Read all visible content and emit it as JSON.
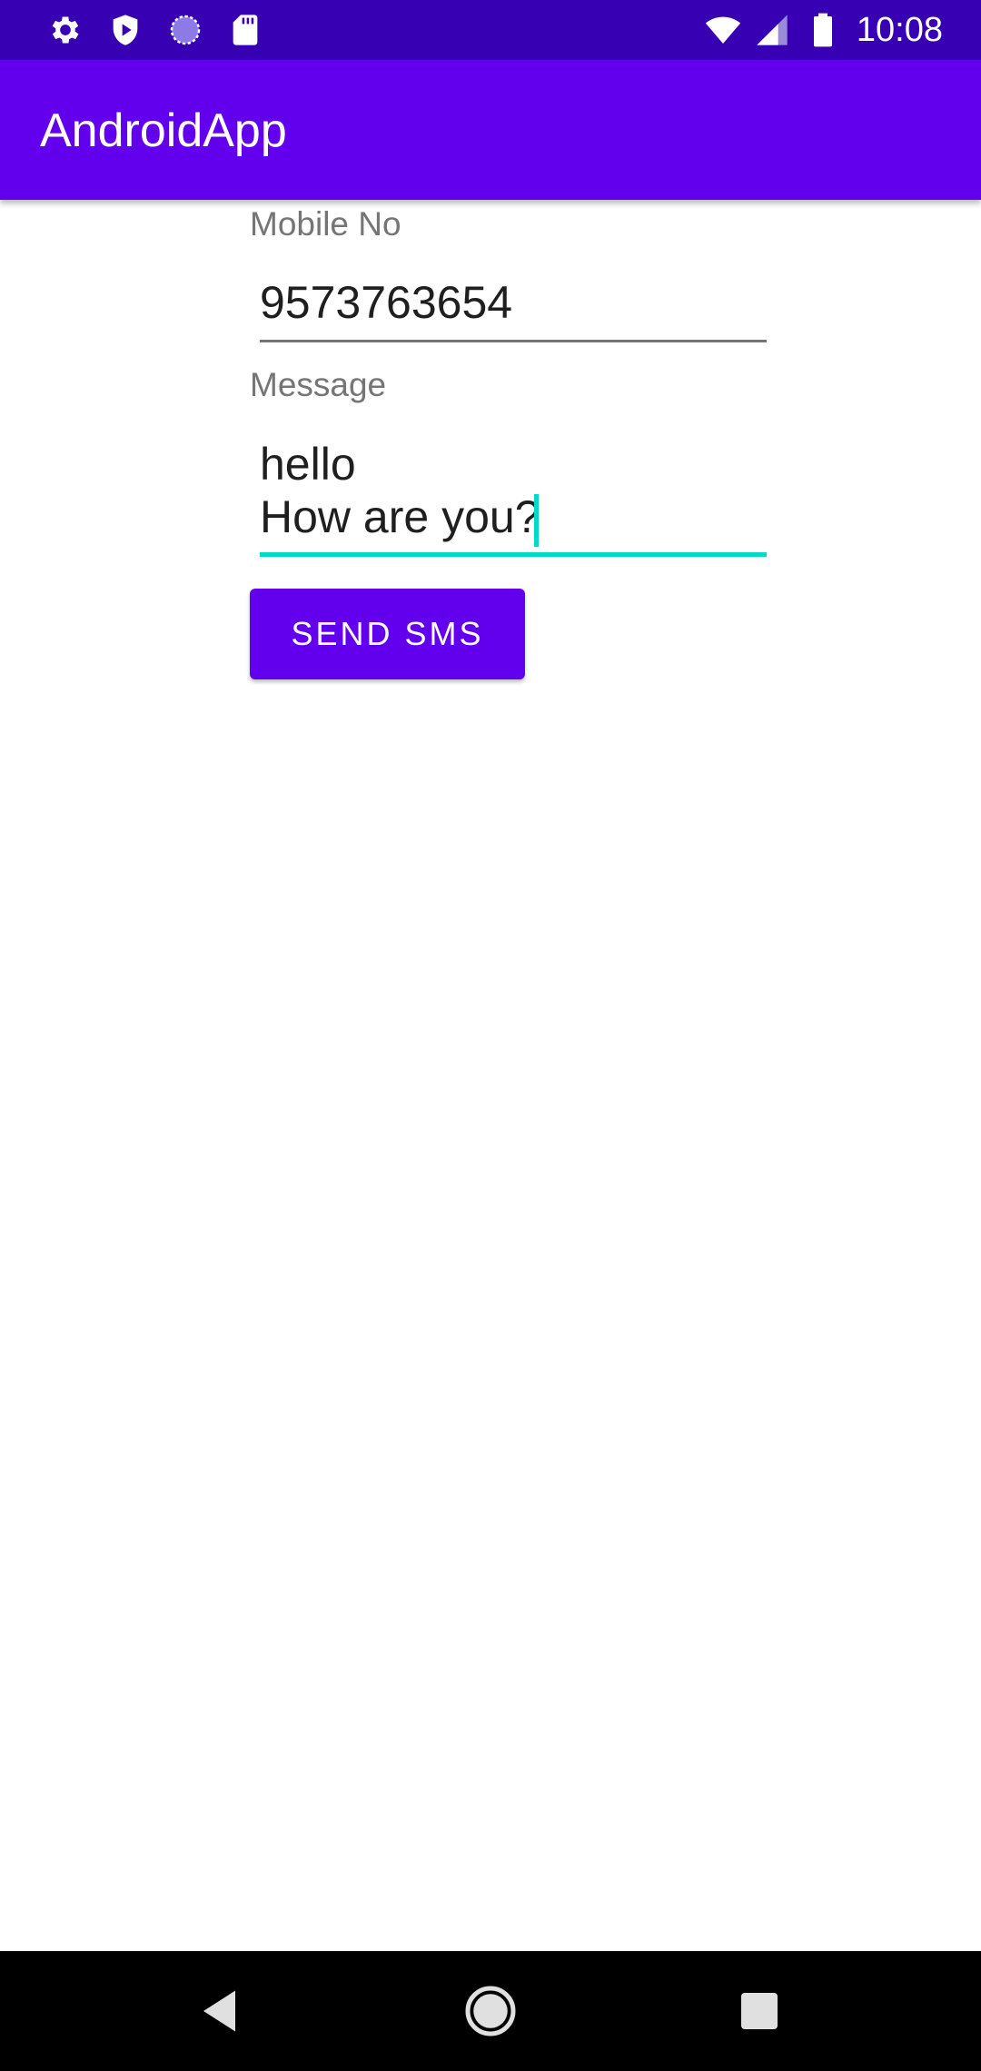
{
  "status_bar": {
    "time": "10:08",
    "icons": [
      "gear-icon",
      "shield-play-icon",
      "loading-circle-icon",
      "sd-card-icon",
      "wifi-icon",
      "signal-icon",
      "battery-icon"
    ]
  },
  "app_bar": {
    "title": "AndroidApp"
  },
  "form": {
    "mobile_label": "Mobile No",
    "mobile_value": "9573763654",
    "message_label": "Message",
    "message_line1": "hello",
    "message_line2": "How are you?",
    "send_label": "SEND SMS"
  },
  "nav_bar": {
    "icons": [
      "back-icon",
      "home-icon",
      "recents-icon"
    ]
  },
  "colors": {
    "status_bar": "#3700b3",
    "primary": "#6200ee",
    "accent": "#03dac5"
  }
}
